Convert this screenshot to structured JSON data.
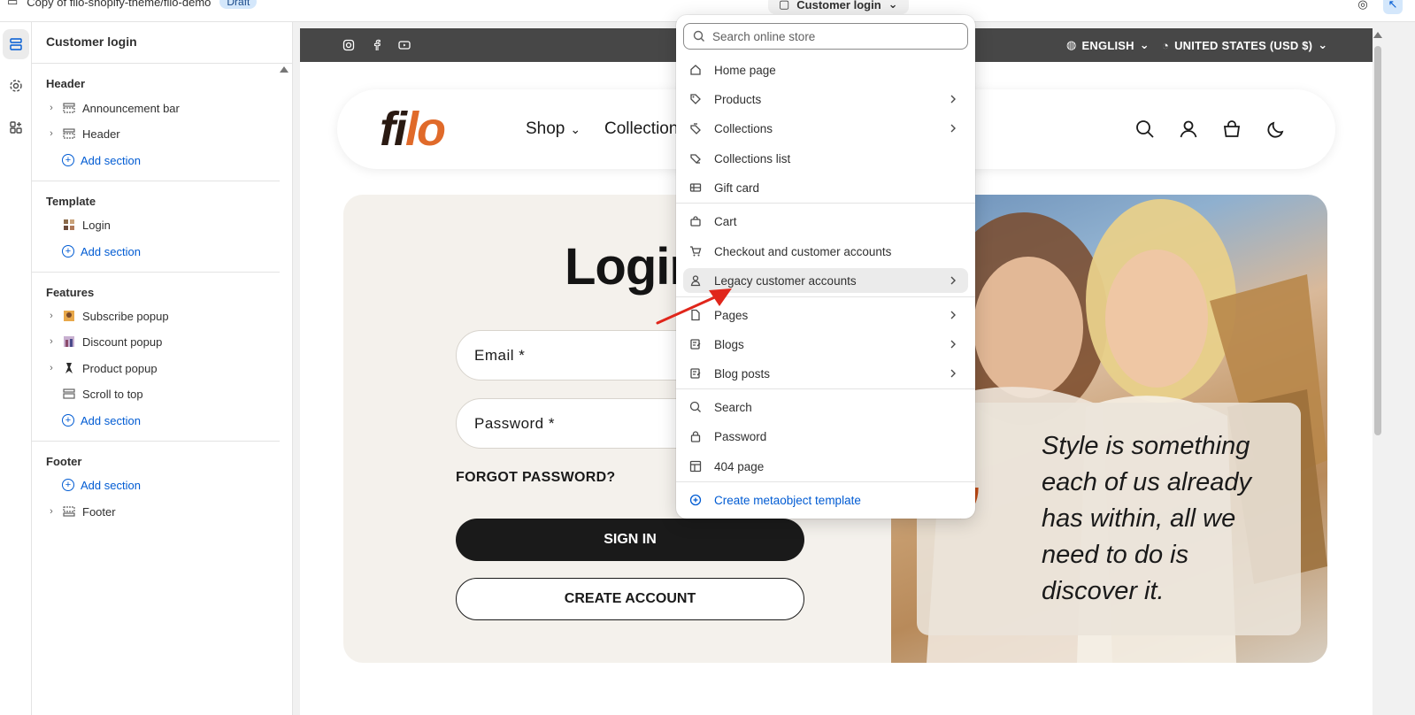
{
  "topbar": {
    "store_title": "Copy of filo-shopify-theme/filo-demo",
    "badge": "Draft",
    "current_template": "Customer login"
  },
  "sidebar": {
    "title": "Customer login",
    "groups": {
      "header": {
        "title": "Header",
        "items": [
          "Announcement bar",
          "Header"
        ],
        "add": "Add section"
      },
      "template": {
        "title": "Template",
        "items": [
          "Login"
        ],
        "add": "Add section"
      },
      "features": {
        "title": "Features",
        "items": [
          "Subscribe popup",
          "Discount popup",
          "Product popup",
          "Scroll to top"
        ],
        "add": "Add section"
      },
      "footer": {
        "title": "Footer",
        "add": "Add section",
        "items": [
          "Footer"
        ]
      }
    }
  },
  "preview": {
    "announcement": {
      "language": "ENGLISH",
      "currency": "UNITED STATES (USD $)"
    },
    "logo_part1": "fi",
    "logo_part2": "lo",
    "nav": {
      "shop": "Shop",
      "collections": "Collection"
    },
    "login": {
      "title": "Login",
      "email_placeholder": "Email *",
      "password_placeholder": "Password *",
      "forgot": "FORGOT PASSWORD?",
      "signin": "SIGN IN",
      "create": "CREATE ACCOUNT"
    },
    "quote": "Style is something each of us already has within, all we need to do is discover it."
  },
  "dropdown": {
    "search_placeholder": "Search online store",
    "items": {
      "home": "Home page",
      "products": "Products",
      "collections": "Collections",
      "collections_list": "Collections list",
      "gift_card": "Gift card",
      "cart": "Cart",
      "checkout": "Checkout and customer accounts",
      "legacy": "Legacy customer accounts",
      "pages": "Pages",
      "blogs": "Blogs",
      "blog_posts": "Blog posts",
      "search": "Search",
      "password": "Password",
      "page404": "404 page",
      "create": "Create metaobject template"
    }
  },
  "colors": {
    "accent": "#005bd3",
    "brand_orange": "#e06a2a",
    "quote_mark": "#c24a14",
    "announcement_bg": "#474747",
    "annotation_arrow": "#e0261b"
  }
}
